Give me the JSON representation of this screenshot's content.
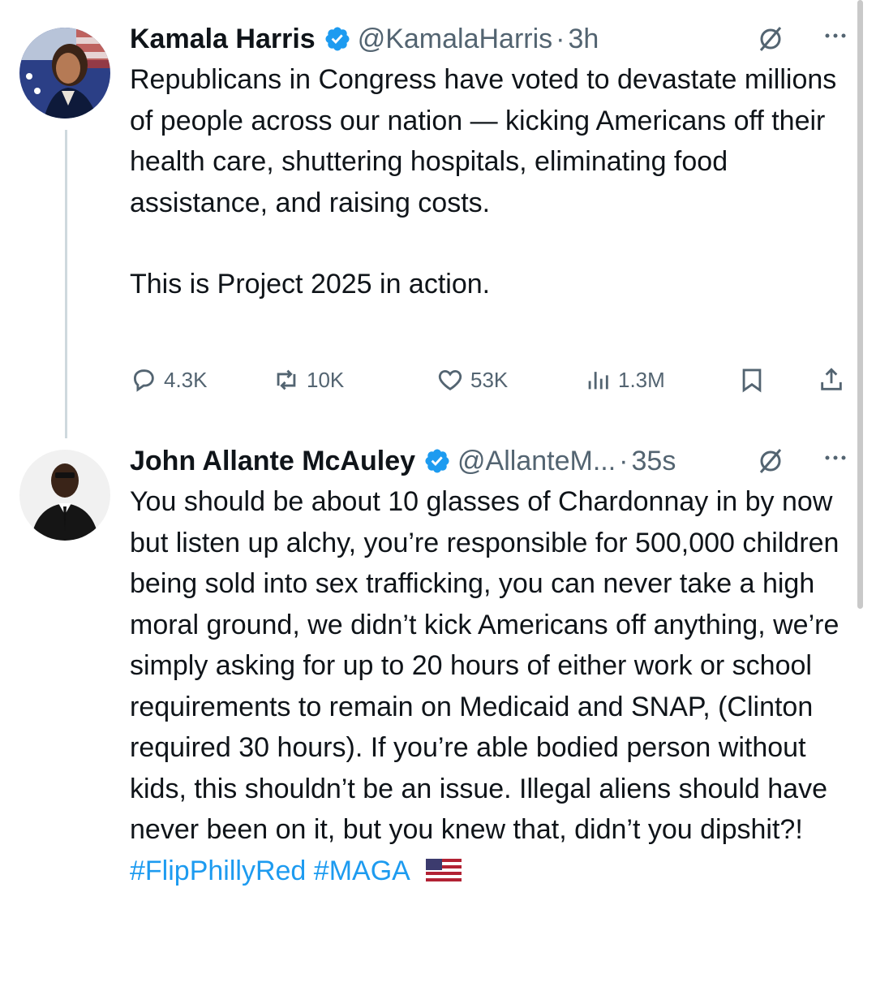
{
  "tweets": [
    {
      "name": "Kamala Harris",
      "handle": "@KamalaHarris",
      "separator": "·",
      "time": "3h",
      "paragraphs": [
        "Republicans in Congress have voted to devastate millions of people across our nation — kicking Americans off their health care, shuttering hospitals, eliminating food assistance, and raising costs.",
        "This is Project 2025 in action."
      ],
      "actions": {
        "replies": "4.3K",
        "reposts": "10K",
        "likes": "53K",
        "views": "1.3M"
      }
    },
    {
      "name": "John Allante McAuley",
      "handle": "@AllanteM...",
      "separator": "·",
      "time": "35s",
      "text": "You should be about 10 glasses of Chardonnay in by now but listen up alchy, you’re responsible for 500,000 children being sold into sex trafficking, you can never take a high moral ground, we didn’t kick Americans off anything, we’re simply asking for up to 20 hours of either work or school requirements to remain on Medicaid and SNAP, (Clinton required 30 hours). If you’re able bodied person without kids, this shouldn’t be an issue. Illegal aliens should have never been on it, but you knew that, didn’t you dipshit?!",
      "hashtags": [
        "#FlipPhillyRed",
        "#MAGA"
      ],
      "flag_icon": "us-flag-emoji"
    }
  ],
  "icons": {
    "verified": "verified-badge-icon",
    "grok": "grok-icon",
    "more": "more-icon",
    "reply": "reply-icon",
    "repost": "repost-icon",
    "like": "like-icon",
    "views": "views-icon",
    "bookmark": "bookmark-icon",
    "share": "share-icon"
  },
  "colors": {
    "text": "#0f1419",
    "secondary": "#536471",
    "link": "#1d9bf0",
    "verified": "#1d9bf0"
  }
}
